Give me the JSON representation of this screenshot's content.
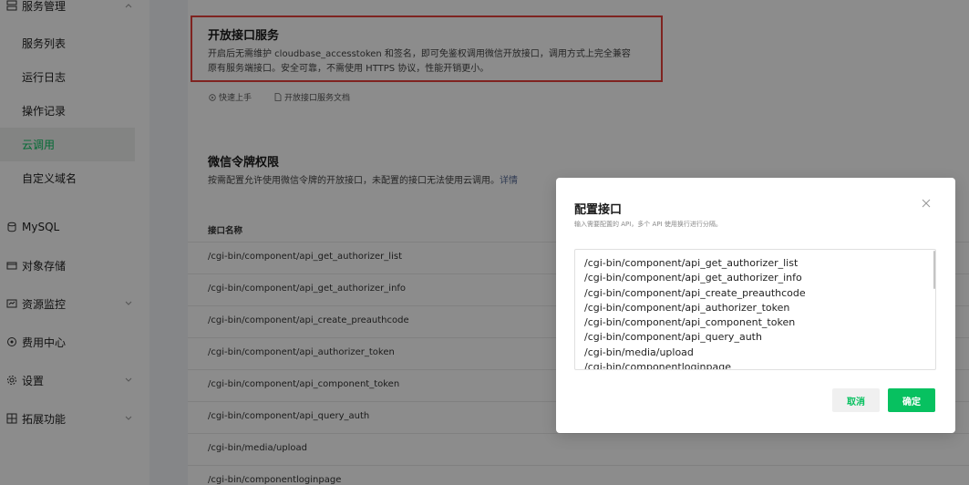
{
  "sidebar": {
    "group_service": "服务管理",
    "items": [
      {
        "label": "服务列表"
      },
      {
        "label": "运行日志"
      },
      {
        "label": "操作记录"
      },
      {
        "label": "云调用"
      },
      {
        "label": "自定义域名"
      }
    ],
    "groups": [
      {
        "label": "MySQL",
        "icon": "database-icon"
      },
      {
        "label": "对象存储",
        "icon": "storage-icon"
      },
      {
        "label": "资源监控",
        "icon": "monitor-icon"
      },
      {
        "label": "费用中心",
        "icon": "billing-icon"
      },
      {
        "label": "设置",
        "icon": "gear-icon"
      },
      {
        "label": "拓展功能",
        "icon": "extension-icon"
      }
    ]
  },
  "open_api": {
    "title": "开放接口服务",
    "desc_line1": "开启后无需维护 cloudbase_accesstoken 和签名，即可免鉴权调用微信开放接口，调用方式上完全兼容",
    "desc_line2": "原有服务端接口。安全可靠，不需使用 HTTPS 协议，性能开销更小。",
    "quick_start": "快速上手",
    "doc_link": "开放接口服务文档"
  },
  "token_perm": {
    "title": "微信令牌权限",
    "desc": "按需配置允许使用微信令牌的开放接口，未配置的接口无法使用云调用。",
    "detail_link": "详情",
    "column_header": "接口名称",
    "rows": [
      "/cgi-bin/component/api_get_authorizer_list",
      "/cgi-bin/component/api_get_authorizer_info",
      "/cgi-bin/component/api_create_preauthcode",
      "/cgi-bin/component/api_authorizer_token",
      "/cgi-bin/component/api_component_token",
      "/cgi-bin/component/api_query_auth",
      "/cgi-bin/media/upload",
      "/cgi-bin/componentloginpage"
    ]
  },
  "modal": {
    "title": "配置接口",
    "subtitle": "输入需要配置的 API，多个 API 使用换行进行分隔。",
    "lines": [
      "/cgi-bin/component/api_get_authorizer_list",
      "/cgi-bin/component/api_get_authorizer_info",
      "/cgi-bin/component/api_create_preauthcode",
      "/cgi-bin/component/api_authorizer_token",
      "/cgi-bin/component/api_component_token",
      "/cgi-bin/component/api_query_auth",
      "/cgi-bin/media/upload",
      "/cgi-bin/componentloginpage"
    ],
    "cancel_label": "取消",
    "ok_label": "确定"
  },
  "colors": {
    "accent": "#07c160",
    "highlight_border": "#e8413b",
    "overlay": "rgba(0,0,0,0.45)"
  }
}
